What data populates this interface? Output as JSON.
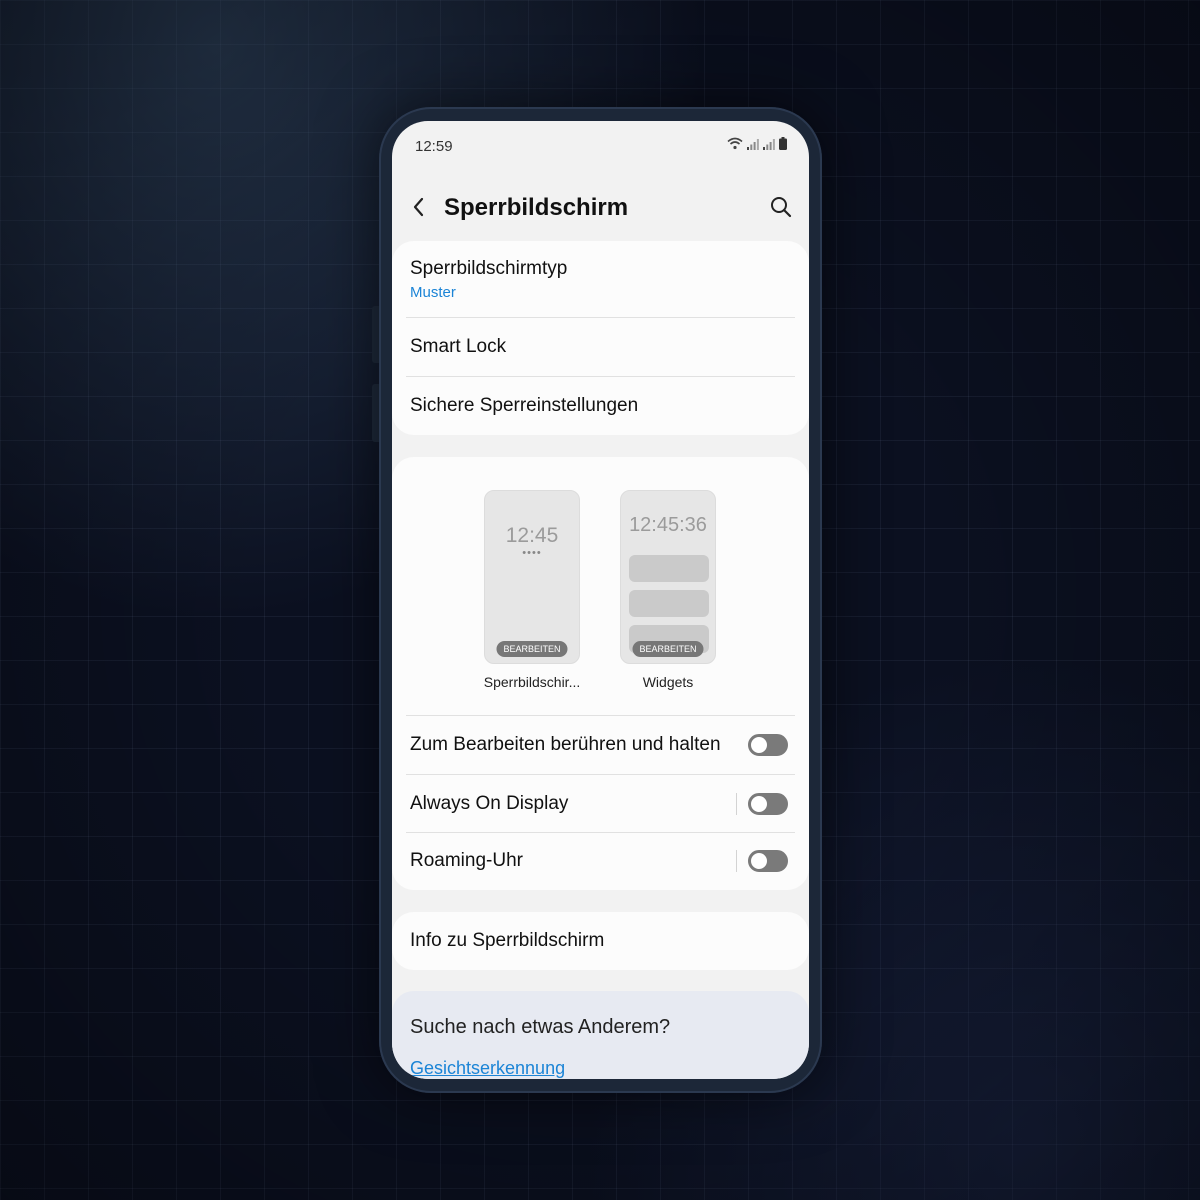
{
  "status_bar": {
    "time": "12:59",
    "icons": [
      "wifi-icon",
      "signal-icon",
      "signal-icon",
      "battery-icon"
    ]
  },
  "header": {
    "title": "Sperrbildschirm",
    "back_icon": "chevron-left-icon",
    "search_icon": "search-icon"
  },
  "group1": {
    "items": [
      {
        "label": "Sperrbildschirmtyp",
        "sub": "Muster"
      },
      {
        "label": "Smart Lock"
      },
      {
        "label": "Sichere Sperreinstellungen"
      }
    ]
  },
  "previews": {
    "lockscreen": {
      "time": "12:45",
      "dots": "••••",
      "edit_label": "BEARBEITEN",
      "caption": "Sperrbildschir..."
    },
    "widgets": {
      "time": "12:45:36",
      "edit_label": "BEARBEITEN",
      "caption": "Widgets"
    }
  },
  "toggles": [
    {
      "label": "Zum Bearbeiten berühren und halten",
      "on": false
    },
    {
      "label": "Always On Display",
      "on": false
    },
    {
      "label": "Roaming-Uhr",
      "on": false
    }
  ],
  "info": {
    "label": "Info zu Sperrbildschirm"
  },
  "suggestion": {
    "title": "Suche nach etwas Anderem?",
    "link": "Gesichtserkennung"
  },
  "colors": {
    "accent": "#1b84d6",
    "background": "#0b1020",
    "screen_bg": "#f2f2f2"
  }
}
